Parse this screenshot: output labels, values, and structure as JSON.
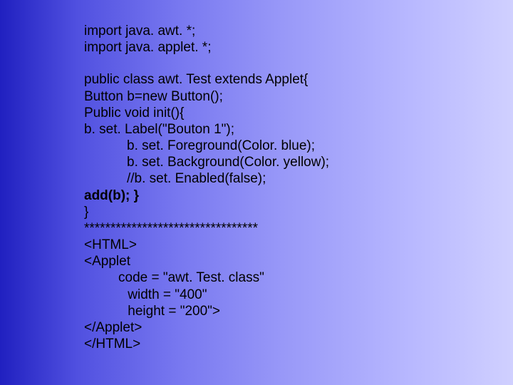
{
  "code": {
    "l1": "import java. awt. *;",
    "l2": "import java. applet. *;",
    "l3": "public class awt. Test extends Applet{",
    "l4": "Button b=new Button();",
    "l5": "Public void init(){",
    "l6": "b. set. Label(\"Bouton 1\");",
    "l7": "b. set. Foreground(Color. blue);",
    "l8": "b. set. Background(Color. yellow);",
    "l9": "//b. set. Enabled(false);",
    "l10": "add(b); }",
    "l11": "}",
    "l12": "*********************************",
    "l13": "<HTML>",
    "l14": "<Applet",
    "l15": "code = \"awt. Test. class\"",
    "l16": " width = \"400\"",
    "l17": " height = \"200\">",
    "l18": "</Applet>",
    "l19": "</HTML>"
  }
}
